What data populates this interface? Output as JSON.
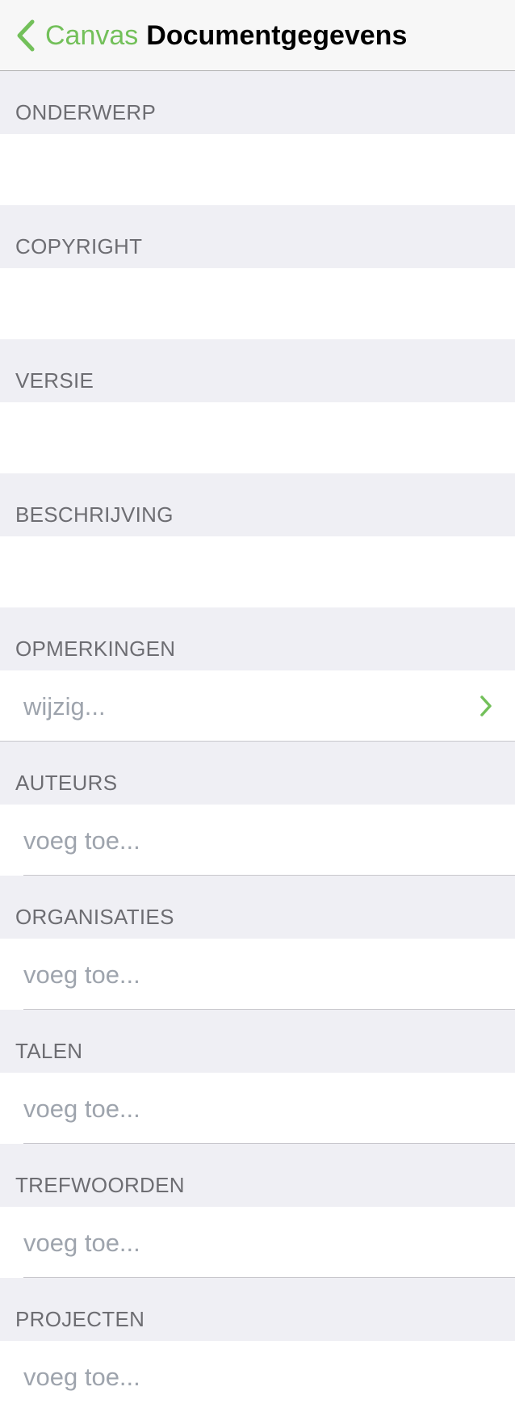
{
  "navbar": {
    "back_label": "Canvas",
    "title": "Documentgegevens"
  },
  "sections": {
    "onderwerp": {
      "header": "ONDERWERP",
      "value": ""
    },
    "copyright": {
      "header": "COPYRIGHT",
      "value": ""
    },
    "versie": {
      "header": "VERSIE",
      "value": ""
    },
    "beschrijving": {
      "header": "BESCHRIJVING",
      "value": ""
    },
    "opmerkingen": {
      "header": "OPMERKINGEN",
      "placeholder": "wijzig..."
    },
    "auteurs": {
      "header": "AUTEURS",
      "placeholder": "voeg toe..."
    },
    "organisaties": {
      "header": "ORGANISATIES",
      "placeholder": "voeg toe..."
    },
    "talen": {
      "header": "TALEN",
      "placeholder": "voeg toe..."
    },
    "trefwoorden": {
      "header": "TREFWOORDEN",
      "placeholder": "voeg toe..."
    },
    "projecten": {
      "header": "PROJECTEN",
      "placeholder": "voeg toe..."
    }
  },
  "colors": {
    "accent": "#73c05a",
    "header_text": "#6d6d72",
    "placeholder_text": "#9ea4ad",
    "group_background": "#efeff4"
  },
  "icons": {
    "back": "chevron-left-icon",
    "disclosure": "chevron-right-icon"
  }
}
